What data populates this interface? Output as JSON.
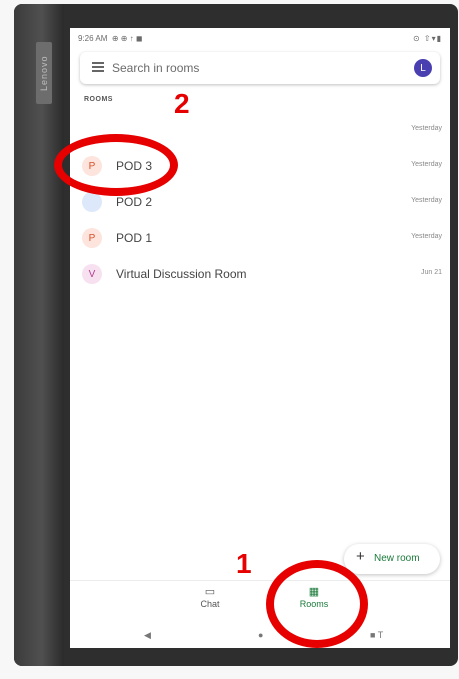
{
  "device": {
    "brand": "Lenovo"
  },
  "status_bar": {
    "time": "9:26 AM",
    "icons": "⊕ ⊕ ↑ ◼",
    "right_icons": "⊙ ⇧▾▮"
  },
  "search": {
    "placeholder": "Search in rooms",
    "avatar_initial": "L"
  },
  "rooms_section": {
    "label": "ROOMS"
  },
  "rooms": [
    {
      "initial": "",
      "name": "",
      "time": "Yesterday",
      "avatar_bg": "#ffffff",
      "avatar_fg": "#ffffff"
    },
    {
      "initial": "P",
      "name": "POD 3",
      "time": "Yesterday",
      "avatar_bg": "#fde4dd",
      "avatar_fg": "#d9502a"
    },
    {
      "initial": "",
      "name": "POD 2",
      "time": "Yesterday",
      "avatar_bg": "#dde9fb",
      "avatar_fg": "#3f6fc9"
    },
    {
      "initial": "P",
      "name": "POD 1",
      "time": "Yesterday",
      "avatar_bg": "#fde4dd",
      "avatar_fg": "#d9502a"
    },
    {
      "initial": "V",
      "name": "Virtual Discussion Room",
      "time": "Jun 21",
      "avatar_bg": "#f7e1f0",
      "avatar_fg": "#b33d8e"
    }
  ],
  "fab": {
    "label": "New room",
    "icon": "+"
  },
  "bottom_nav": {
    "chat_label": "Chat",
    "rooms_label": "Rooms"
  },
  "system_nav": {
    "back": "◀",
    "home": "●",
    "recents": "■ T"
  },
  "annotations": {
    "step_1": "1",
    "step_2": "2"
  },
  "colors": {
    "accent_green": "#1b7a3a",
    "annotation_red": "#e60000"
  }
}
